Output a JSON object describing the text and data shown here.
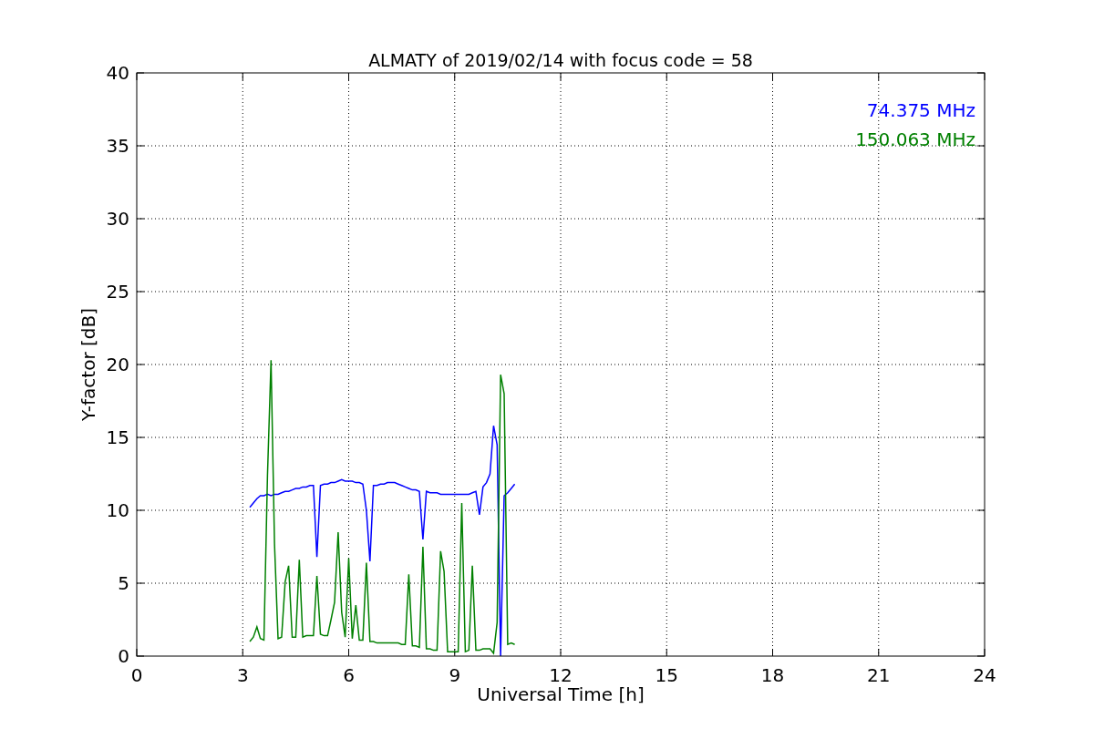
{
  "figure": {
    "chart_data": {
      "type": "line",
      "grid": true,
      "title": "ALMATY of 2019/02/14 with focus code = 58",
      "xlabel": "Universal Time [h]",
      "ylabel": "Y-factor [dB]",
      "xlim": [
        0,
        24
      ],
      "ylim": [
        0,
        40
      ],
      "xticks": [
        0,
        3,
        6,
        9,
        12,
        15,
        18,
        21,
        24
      ],
      "yticks": [
        0,
        5,
        10,
        15,
        20,
        25,
        30,
        35,
        40
      ],
      "x": [
        3.2,
        3.3,
        3.4,
        3.5,
        3.6,
        3.7,
        3.8,
        3.9,
        4.0,
        4.1,
        4.2,
        4.3,
        4.4,
        4.5,
        4.6,
        4.7,
        4.8,
        4.9,
        5.0,
        5.1,
        5.2,
        5.3,
        5.4,
        5.5,
        5.6,
        5.7,
        5.8,
        5.9,
        6.0,
        6.1,
        6.2,
        6.3,
        6.4,
        6.5,
        6.6,
        6.7,
        6.8,
        6.9,
        7.0,
        7.1,
        7.2,
        7.3,
        7.4,
        7.5,
        7.6,
        7.7,
        7.8,
        7.9,
        8.0,
        8.1,
        8.2,
        8.3,
        8.4,
        8.5,
        8.6,
        8.7,
        8.8,
        8.9,
        9.0,
        9.1,
        9.2,
        9.3,
        9.4,
        9.5,
        9.6,
        9.7,
        9.8,
        9.9,
        10.0,
        10.1,
        10.2,
        10.3,
        10.4,
        10.5,
        10.6,
        10.7
      ],
      "series": [
        {
          "name": "74.375 MHz",
          "color": "#0000ff",
          "values": [
            10.2,
            10.5,
            10.8,
            11.0,
            11.0,
            11.1,
            11.0,
            11.1,
            11.1,
            11.2,
            11.3,
            11.3,
            11.4,
            11.5,
            11.5,
            11.6,
            11.6,
            11.7,
            11.7,
            6.8,
            11.7,
            11.8,
            11.8,
            11.9,
            11.9,
            12.0,
            12.1,
            12.0,
            12.0,
            12.0,
            11.9,
            11.9,
            11.8,
            10.0,
            6.5,
            11.7,
            11.7,
            11.8,
            11.8,
            11.9,
            11.9,
            11.9,
            11.8,
            11.7,
            11.6,
            11.5,
            11.4,
            11.4,
            11.3,
            8.0,
            11.3,
            11.2,
            11.2,
            11.2,
            11.1,
            11.1,
            11.1,
            11.1,
            11.1,
            11.1,
            11.1,
            11.1,
            11.1,
            11.2,
            11.3,
            9.7,
            11.6,
            11.9,
            12.5,
            15.8,
            14.5,
            0.0,
            11.0,
            11.2,
            11.5,
            11.8
          ]
        },
        {
          "name": "150.063 MHz",
          "color": "#008000",
          "values": [
            1.0,
            1.3,
            2.0,
            1.2,
            1.1,
            12.4,
            20.3,
            7.7,
            1.2,
            1.3,
            5.1,
            6.2,
            1.3,
            1.3,
            6.6,
            1.3,
            1.4,
            1.4,
            1.4,
            5.5,
            1.5,
            1.4,
            1.4,
            2.5,
            3.7,
            8.5,
            3.0,
            1.3,
            6.7,
            1.2,
            3.5,
            1.1,
            1.1,
            6.4,
            1.0,
            1.0,
            0.9,
            0.9,
            0.9,
            0.9,
            0.9,
            0.9,
            0.9,
            0.8,
            0.8,
            5.6,
            0.7,
            0.7,
            0.6,
            7.5,
            0.5,
            0.5,
            0.4,
            0.4,
            7.2,
            5.8,
            0.3,
            0.3,
            0.3,
            0.3,
            10.5,
            0.3,
            0.4,
            6.2,
            0.4,
            0.4,
            0.5,
            0.5,
            0.5,
            0.2,
            2.3,
            19.3,
            18.0,
            0.8,
            0.9,
            0.8
          ]
        }
      ]
    }
  }
}
